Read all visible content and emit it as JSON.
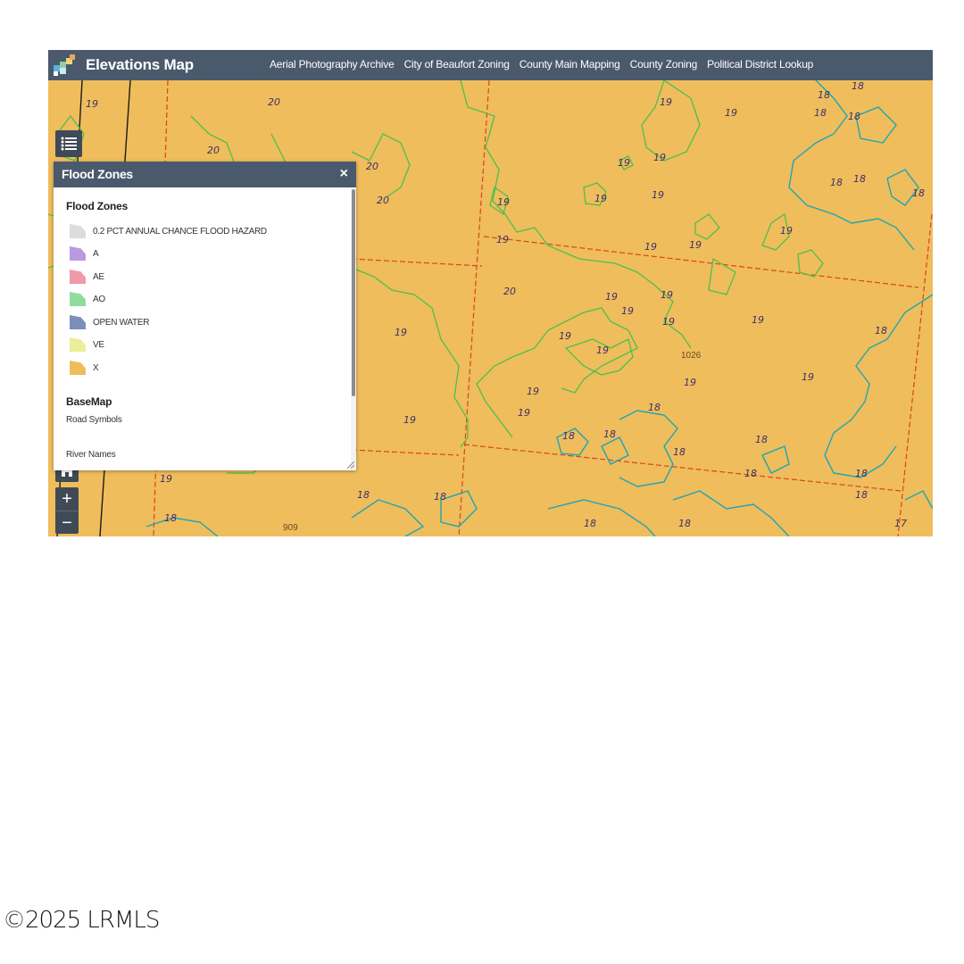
{
  "header": {
    "title": "Elevations Map",
    "nav": [
      "Aerial Photography Archive",
      "City of Beaufort Zoning",
      "County Main Mapping",
      "County Zoning",
      "Political District Lookup"
    ]
  },
  "legend_panel": {
    "title": "Flood Zones",
    "close_glyph": "×",
    "section_title": "Flood Zones",
    "items": [
      {
        "label": "0.2 PCT ANNUAL CHANCE FLOOD HAZARD",
        "color": "#dcdcdc"
      },
      {
        "label": "A",
        "color": "#b99ae0"
      },
      {
        "label": "AE",
        "color": "#ef9aa6"
      },
      {
        "label": "AO",
        "color": "#8fdc9c"
      },
      {
        "label": "OPEN WATER",
        "color": "#7c8fb8"
      },
      {
        "label": "VE",
        "color": "#ecee9c"
      },
      {
        "label": "X",
        "color": "#efbd5c"
      }
    ],
    "basemap_title": "BaseMap",
    "road_symbols": "Road Symbols",
    "river_names": "River Names"
  },
  "map": {
    "contour_labels": [
      "19",
      "20",
      "20",
      "20",
      "20",
      "19",
      "19",
      "19",
      "19",
      "19",
      "19",
      "19",
      "19",
      "19",
      "19",
      "19",
      "19",
      "19",
      "19",
      "19",
      "19",
      "19",
      "19",
      "19",
      "19",
      "19",
      "18",
      "18",
      "18",
      "18",
      "18",
      "18",
      "18",
      "18",
      "18",
      "18",
      "18",
      "18",
      "18",
      "18",
      "18",
      "18",
      "18",
      "18",
      "18",
      "17",
      "20",
      "19",
      "19",
      "19",
      "19",
      "18",
      "18"
    ],
    "parcel_labels": [
      "1026",
      "909"
    ]
  },
  "controls": {
    "zoom_in": "+",
    "zoom_out": "−"
  },
  "footer": {
    "copyright": "©2025 LRMLS"
  }
}
